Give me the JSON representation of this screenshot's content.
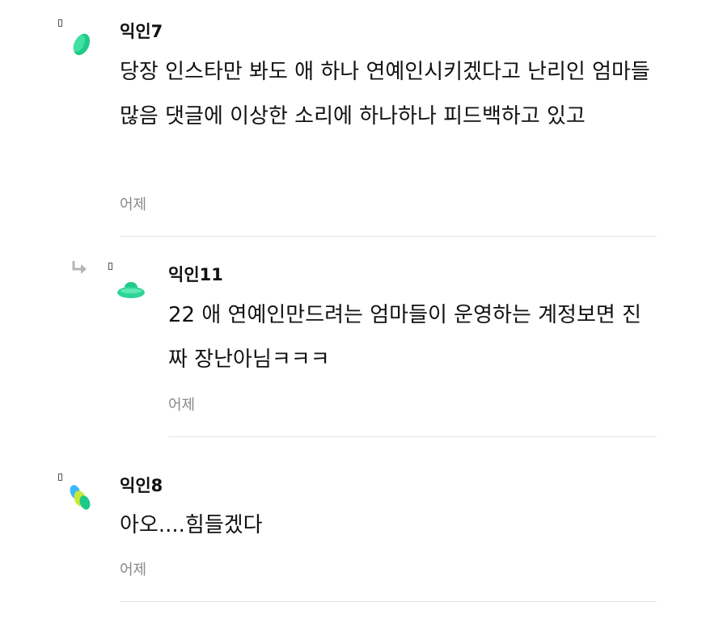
{
  "comments": [
    {
      "author": "익인7",
      "text": "당장 인스타만 봐도 애 하나 연예인시키겠다고 난리인 엄마들 많음 댓글에 이상한 소리에 하나하나 피드백하고 있고",
      "time": "어제",
      "avatar_icon": "green-blob-avatar",
      "is_reply": false
    },
    {
      "author": "익인11",
      "text": "22 애 연예인만드려는 엄마들이 운영하는 계정보면 진짜 장난아님ㅋㅋㅋ",
      "time": "어제",
      "avatar_icon": "green-ufo-avatar",
      "is_reply": true
    },
    {
      "author": "익인8",
      "text": "아오....힘들겠다",
      "time": "어제",
      "avatar_icon": "multicolor-avatar",
      "is_reply": false
    }
  ],
  "colors": {
    "avatar_green": "#1ec98a",
    "time_gray": "#8a8a8a",
    "divider": "#e4e4e4"
  }
}
